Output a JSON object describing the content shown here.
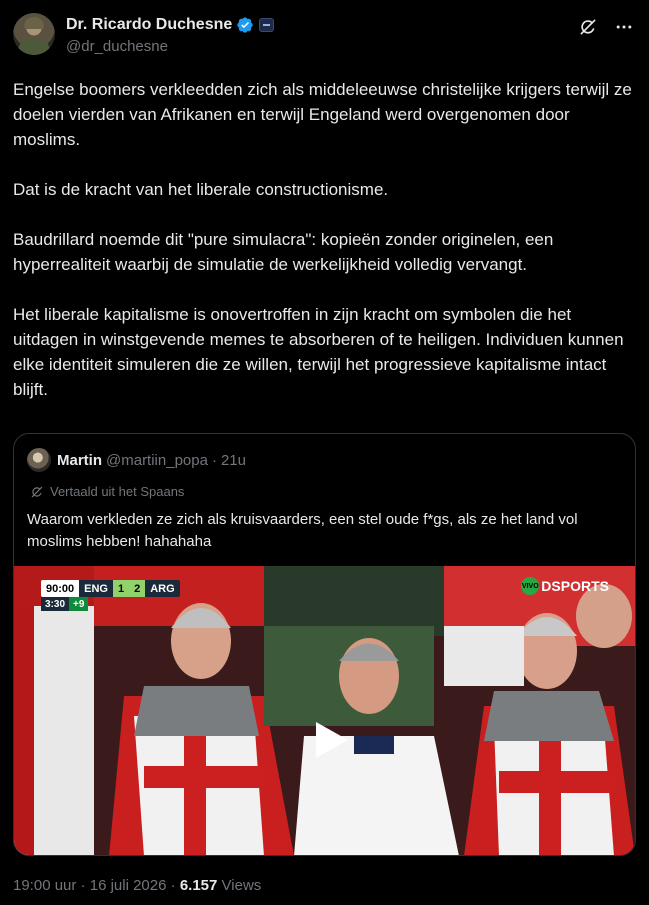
{
  "author": {
    "display_name": "Dr. Ricardo Duchesne",
    "handle": "@dr_duchesne",
    "verified_color": "#1d9bf0"
  },
  "tweet": {
    "paragraphs": [
      "Engelse boomers verkleedden zich als middeleeuwse christelijke krijgers terwijl ze doelen vierden van Afrikanen en terwijl Engeland werd overgenomen door moslims.",
      "Dat is de kracht van het liberale constructionisme.",
      "Baudrillard noemde dit \"pure simulacra\": kopieën zonder originelen, een hyperrealiteit waarbij de simulatie de werkelijkheid volledig vervangt.",
      "Het liberale kapitalisme is onovertroffen in zijn kracht om symbolen die het uitdagen in winstgevende memes te absorberen of te heiligen. Individuen kunnen elke identiteit simuleren die ze willen, terwijl het progressieve kapitalisme intact blijft."
    ]
  },
  "quote": {
    "display_name": "Martin",
    "handle": "@martiin_popa",
    "separator": "·",
    "time": "21u",
    "translated_label": "Vertaald uit het Spaans",
    "text": "Waarom verkleden ze zich als kruisvaarders, een stel oude f*gs, als ze het land vol moslims hebben! hahahaha",
    "video": {
      "scoreboard": {
        "clock": "90:00",
        "home": "ENG",
        "home_score": "1",
        "away_score": "2",
        "away": "ARG",
        "period_clock": "3:30",
        "added_time": "+9"
      },
      "broadcaster_badge": "VIVO",
      "broadcaster": "SPORTS",
      "broadcaster_mark": "D"
    }
  },
  "meta": {
    "time": "19:00 uur",
    "separator": "·",
    "date": "16 juli 2026",
    "separator2": "·",
    "views_count": "6.157",
    "views_label": "Views"
  }
}
